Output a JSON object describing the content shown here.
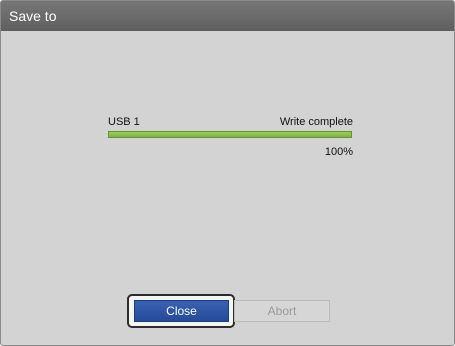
{
  "dialog": {
    "title": "Save to"
  },
  "device": {
    "name": "USB 1",
    "status": "Write complete",
    "progress_percent": 100,
    "progress_text": "100%"
  },
  "buttons": {
    "close_label": "Close",
    "abort_label": "Abort",
    "abort_enabled": false
  },
  "colors": {
    "titlebar": "#6b6b6b",
    "dialog_bg": "#d3d3d3",
    "progress_fill": "#8cc34b",
    "primary_button": "#2f56a7"
  }
}
